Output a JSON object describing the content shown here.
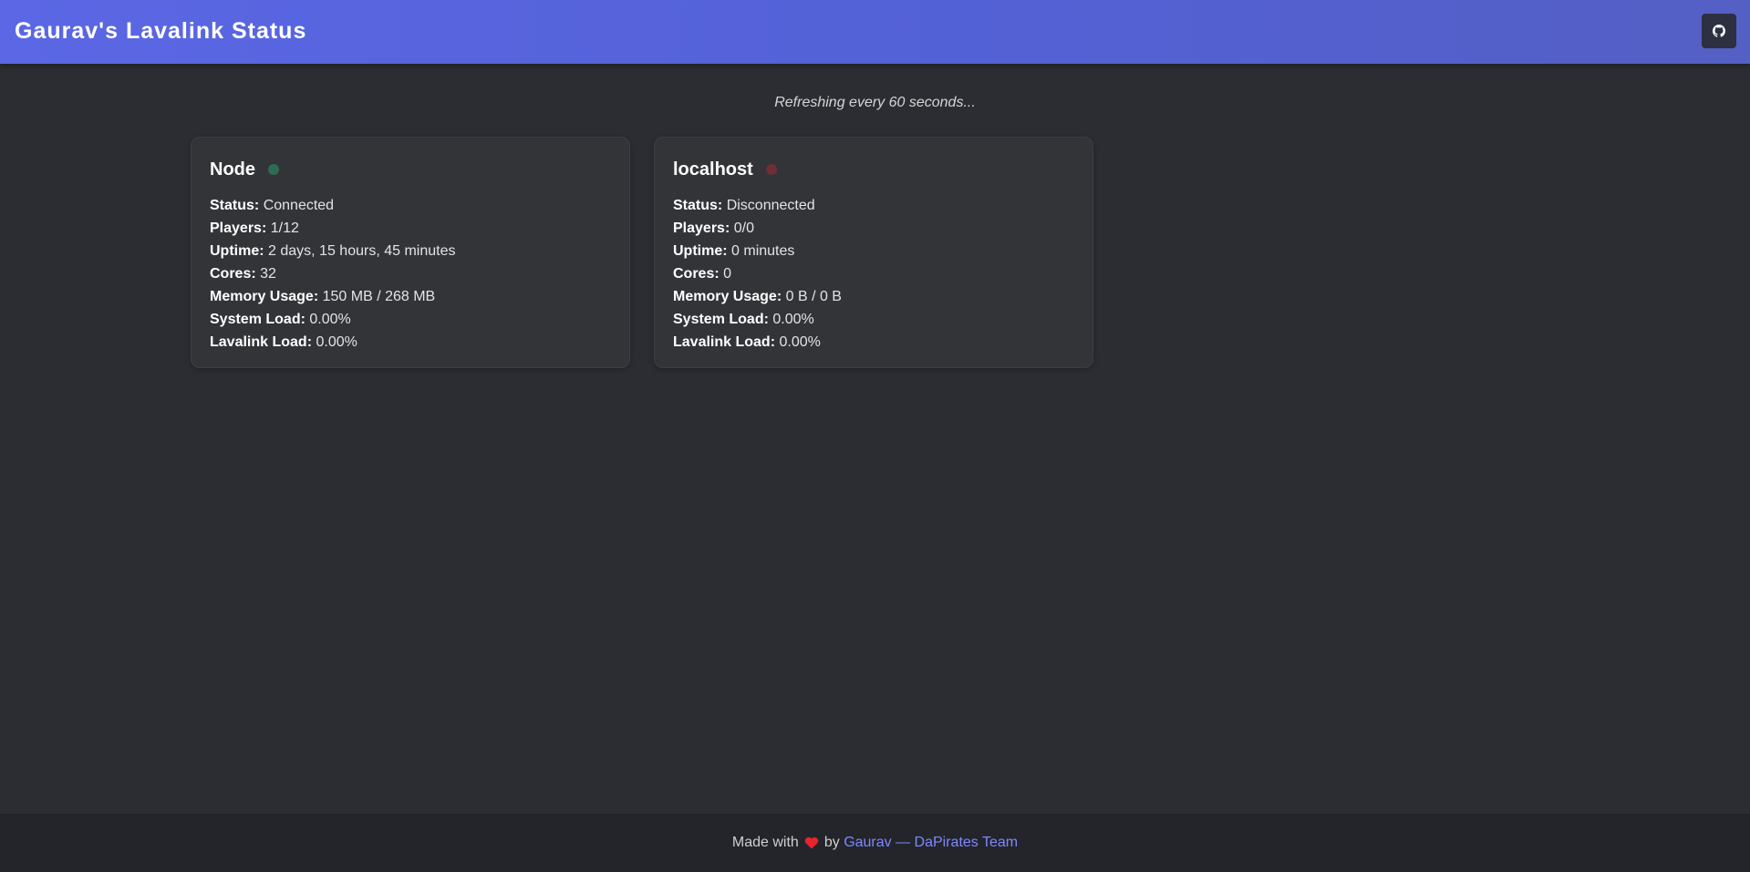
{
  "header": {
    "title": "Gaurav's Lavalink Status",
    "github_icon": "github-icon"
  },
  "refresh_note": "Refreshing every 60 seconds...",
  "colors": {
    "header_start": "#5b67e4",
    "header_end": "#5460c4",
    "connected": "#2f6b52",
    "disconnected": "#6e2e35",
    "link": "#7f88ff",
    "heart": "#e8232e"
  },
  "nodes": [
    {
      "name": "Node",
      "status_icon": "connected-dot-icon",
      "stats": [
        {
          "label": "Status:",
          "value": "Connected"
        },
        {
          "label": "Players:",
          "value": "1/12"
        },
        {
          "label": "Uptime:",
          "value": "2 days, 15 hours, 45 minutes"
        },
        {
          "label": "Cores:",
          "value": "32"
        },
        {
          "label": "Memory Usage:",
          "value": "150 MB / 268 MB"
        },
        {
          "label": "System Load:",
          "value": "0.00%"
        },
        {
          "label": "Lavalink Load:",
          "value": "0.00%"
        }
      ]
    },
    {
      "name": "localhost",
      "status_icon": "disconnected-dot-icon",
      "stats": [
        {
          "label": "Status:",
          "value": "Disconnected"
        },
        {
          "label": "Players:",
          "value": "0/0"
        },
        {
          "label": "Uptime:",
          "value": "0 minutes"
        },
        {
          "label": "Cores:",
          "value": "0"
        },
        {
          "label": "Memory Usage:",
          "value": "0 B / 0 B"
        },
        {
          "label": "System Load:",
          "value": "0.00%"
        },
        {
          "label": "Lavalink Load:",
          "value": "0.00%"
        }
      ]
    }
  ],
  "footer": {
    "prefix": "Made with",
    "heart_icon": "heart-icon",
    "by": "by",
    "link_text": "Gaurav — DaPirates Team"
  }
}
